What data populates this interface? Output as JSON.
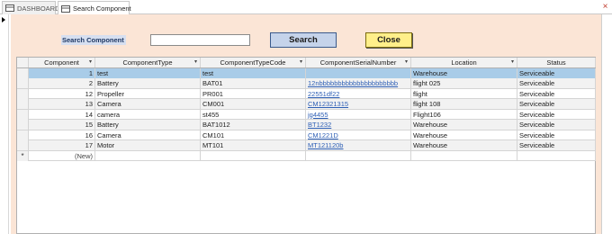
{
  "tabs": [
    {
      "label": "DASHBOARD",
      "active": false,
      "icon": "form-icon"
    },
    {
      "label": "Search Component",
      "active": true,
      "icon": "form-icon"
    }
  ],
  "form": {
    "search_label": "Search Component",
    "search_value": "",
    "search_button": "Search",
    "close_button": "Close"
  },
  "table": {
    "columns": [
      {
        "label": "Component",
        "sortable": true
      },
      {
        "label": "ComponentType",
        "sortable": true
      },
      {
        "label": "ComponentTypeCode",
        "sortable": true
      },
      {
        "label": "ComponentSerialNumber",
        "sortable": true
      },
      {
        "label": "Location",
        "sortable": true
      },
      {
        "label": "Status",
        "sortable": false
      }
    ],
    "rows": [
      {
        "component": "1",
        "type": "test",
        "code": "test",
        "serial": "",
        "location": "Warehouse",
        "status": "Serviceable"
      },
      {
        "component": "2",
        "type": "Battery",
        "code": "BAT01",
        "serial": "12nbbbbbbbbbbbbbbbbbbbbb",
        "location": "flight 025",
        "status": "Serviceable"
      },
      {
        "component": "12",
        "type": "Propeller",
        "code": "PR001",
        "serial": "22551df22",
        "location": "flight",
        "status": "Serviceable"
      },
      {
        "component": "13",
        "type": "Camera",
        "code": "CM001",
        "serial": "CM12321315",
        "location": "flight 108",
        "status": "Serviceable"
      },
      {
        "component": "14",
        "type": "camera",
        "code": "st455",
        "serial": "jg4455",
        "location": "Flight106",
        "status": "Serviceable"
      },
      {
        "component": "15",
        "type": "Battery",
        "code": "BAT1012",
        "serial": "BT1232",
        "location": "Warehouse",
        "status": "Serviceable"
      },
      {
        "component": "16",
        "type": "Camera",
        "code": "CM101",
        "serial": "CM1221D",
        "location": "Warehouse",
        "status": "Serviceable"
      },
      {
        "component": "17",
        "type": "Motor",
        "code": "MT101",
        "serial": "MT121120b",
        "location": "Warehouse",
        "status": "Serviceable"
      }
    ],
    "new_row": {
      "marker": "*",
      "label": "(New)"
    }
  },
  "colors": {
    "form_background": "#fbe5d6",
    "selected_row": "#a9cce8",
    "search_button": "#c5d3ea",
    "close_button": "#ffef8a",
    "link": "#2e5fb5"
  }
}
